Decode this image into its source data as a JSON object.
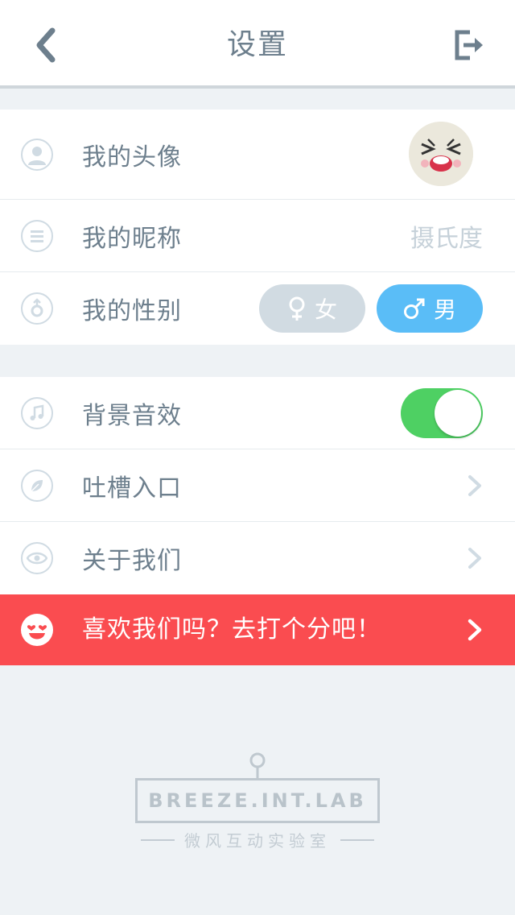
{
  "header": {
    "title": "设置"
  },
  "profile": {
    "avatar_label": "我的头像",
    "nickname_label": "我的昵称",
    "nickname_value": "摄氏度",
    "gender_label": "我的性别",
    "gender_options": {
      "female": "女",
      "male": "男"
    },
    "selected_gender": "male"
  },
  "settings": {
    "bgm_label": "背景音效",
    "bgm_on": true,
    "feedback_label": "吐槽入口",
    "about_label": "关于我们"
  },
  "rate": {
    "text": "喜欢我们吗？去打个分吧！"
  },
  "brand": {
    "name": "BREEZE.INT.LAB",
    "subtitle": "微风互动实验室"
  },
  "colors": {
    "accent_blue": "#5abdf7",
    "toggle_green": "#4ed063",
    "rate_red": "#fa4c50",
    "text_gray": "#6d7f8d"
  }
}
